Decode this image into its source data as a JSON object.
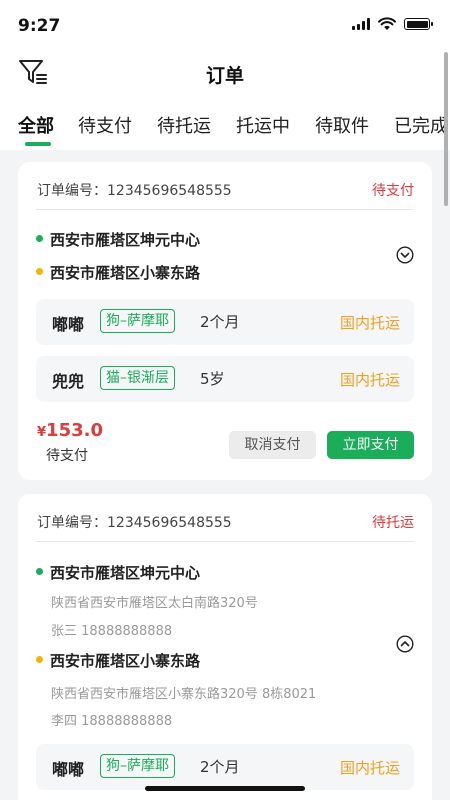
{
  "status_bar": {
    "time": "9:27"
  },
  "header": {
    "title": "订单"
  },
  "tabs": [
    {
      "label": "全部",
      "active": true
    },
    {
      "label": "待支付"
    },
    {
      "label": "待托运"
    },
    {
      "label": "托运中"
    },
    {
      "label": "待取件"
    },
    {
      "label": "已完成"
    }
  ],
  "orders": [
    {
      "order_no_label": "订单编号：12345696548555",
      "status": "待支付",
      "from": {
        "address": "西安市雁塔区坤元中心"
      },
      "to": {
        "address": "西安市雁塔区小寨东路"
      },
      "pets": [
        {
          "name": "嘟嘟",
          "tag": "狗–萨摩耶",
          "age": "2个月",
          "transport": "国内托运"
        },
        {
          "name": "兜兜",
          "tag": "猫–银渐层",
          "age": "5岁",
          "transport": "国内托运"
        }
      ],
      "price_currency": "¥",
      "price_value": "153.0",
      "price_label": "待支付",
      "cancel_label": "取消支付",
      "pay_label": "立即支付"
    },
    {
      "order_no_label": "订单编号：12345696548555",
      "status": "待托运",
      "from": {
        "address": "西安市雁塔区坤元中心",
        "detail": "陕西省西安市雁塔区太白南路320号",
        "contact": "张三   18888888888"
      },
      "to": {
        "address": "西安市雁塔区小寨东路",
        "detail": "陕西省西安市雁塔区小寨东路320号 8栋8021",
        "contact": "李四   18888888888"
      },
      "pets": [
        {
          "name": "嘟嘟",
          "tag": "狗–萨摩耶",
          "age": "2个月",
          "transport": "国内托运"
        }
      ]
    }
  ],
  "colors": {
    "accent": "#1aad5a",
    "danger": "#e03a3a",
    "warning": "#f0a020",
    "dot_orange": "#f5b400"
  },
  "icons": {
    "filter": "filter-icon",
    "expand": "chevron-down-icon",
    "collapse": "chevron-up-icon"
  }
}
